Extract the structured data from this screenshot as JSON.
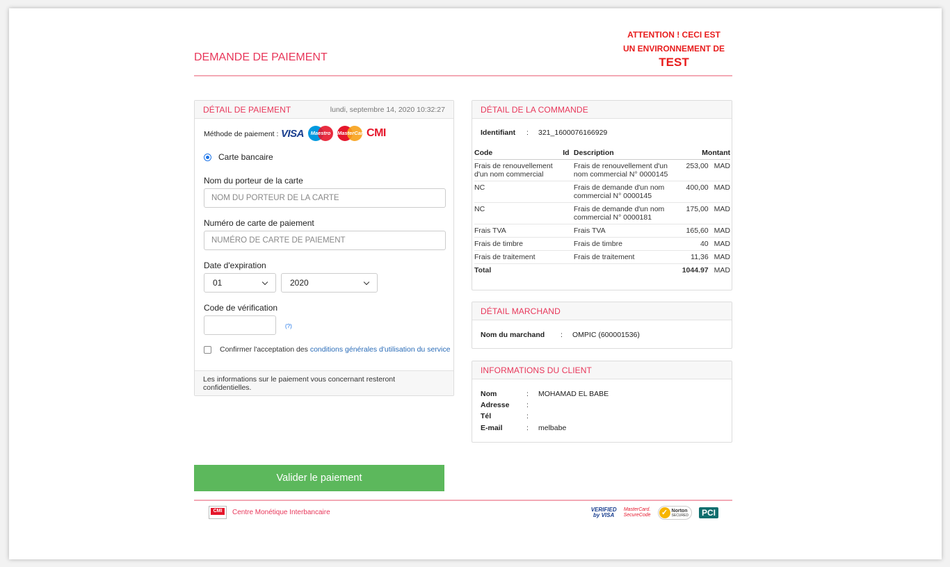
{
  "header": {
    "title": "DEMANDE DE PAIEMENT",
    "warning_line1": "ATTENTION ! CECI EST",
    "warning_line2": "UN ENVIRONNEMENT DE",
    "warning_line3": "TEST"
  },
  "payment": {
    "panel_title": "DÉTAIL DE PAIEMENT",
    "date": "lundi, septembre 14, 2020 10:32:27",
    "method_label": "Méthode de paiement :",
    "logos": [
      "VISA",
      "Maestro",
      "MasterCard",
      "CMI"
    ],
    "radio_label": "Carte bancaire",
    "holder_label": "Nom du porteur de la carte",
    "holder_placeholder": "NOM DU PORTEUR DE LA CARTE",
    "card_label": "Numéro de carte de paiement",
    "card_placeholder": "NUMÉRO DE CARTE DE PAIEMENT",
    "expiry_label": "Date d'expiration",
    "expiry_month": "01",
    "expiry_year": "2020",
    "cvv_label": "Code de vérification",
    "cvv_help": "(?)",
    "terms_prefix": "Confirmer l'acceptation des",
    "terms_link": "conditions générales d'utilisation du service",
    "footer_note": "Les informations sur le paiement vous concernant resteront confidentielles."
  },
  "order": {
    "panel_title": "DÉTAIL DE LA COMMANDE",
    "id_label": "Identifiant",
    "id_sep": ":",
    "id_value": "321_1600076166929",
    "columns": {
      "code": "Code",
      "id": "Id",
      "description": "Description",
      "amount": "Montant"
    },
    "rows": [
      {
        "code": "Frais de renouvellement d'un nom commercial",
        "description": "Frais de renouvellement d'un nom commercial N° 0000145",
        "amount": "253,00",
        "currency": "MAD"
      },
      {
        "code": "NC",
        "description": "Frais de demande d'un nom commercial N° 0000145",
        "amount": "400,00",
        "currency": "MAD"
      },
      {
        "code": "NC",
        "description": "Frais de demande d'un nom commercial N° 0000181",
        "amount": "175,00",
        "currency": "MAD"
      },
      {
        "code": "Frais TVA",
        "description": "Frais TVA",
        "amount": "165,60",
        "currency": "MAD"
      },
      {
        "code": "Frais de timbre",
        "description": "Frais de timbre",
        "amount": "40",
        "currency": "MAD"
      },
      {
        "code": "Frais de traitement",
        "description": "Frais de traitement",
        "amount": "11,36",
        "currency": "MAD"
      }
    ],
    "total_label": "Total",
    "total_value": "1044.97",
    "total_currency": "MAD"
  },
  "merchant": {
    "panel_title": "DÉTAIL MARCHAND",
    "name_label": "Nom du marchand",
    "sep": ":",
    "name_value": "OMPIC (600001536)"
  },
  "client": {
    "panel_title": "INFORMATIONS DU CLIENT",
    "sep": ":",
    "fields": [
      {
        "label": "Nom",
        "value": "MOHAMAD EL BABE"
      },
      {
        "label": "Adresse",
        "value": ""
      },
      {
        "label": "Tél",
        "value": ""
      },
      {
        "label": "E-mail",
        "value": "melbabe"
      }
    ]
  },
  "actions": {
    "submit_label": "Valider le paiement"
  },
  "footer": {
    "cmi_badge": "CMI",
    "cmi_text": "Centre Monétique Interbancaire",
    "seal_visa_1": "VERIFIED",
    "seal_visa_2": "by VISA",
    "seal_mc_1": "MasterCard.",
    "seal_mc_2": "SecureCode",
    "seal_norton": "Norton",
    "seal_norton_sub": "SECURED",
    "seal_pci": "PCI"
  },
  "colors": {
    "accent": "#e8375a",
    "button": "#5cb85c",
    "warning": "#e81c1c",
    "link": "#2a6cb8"
  }
}
